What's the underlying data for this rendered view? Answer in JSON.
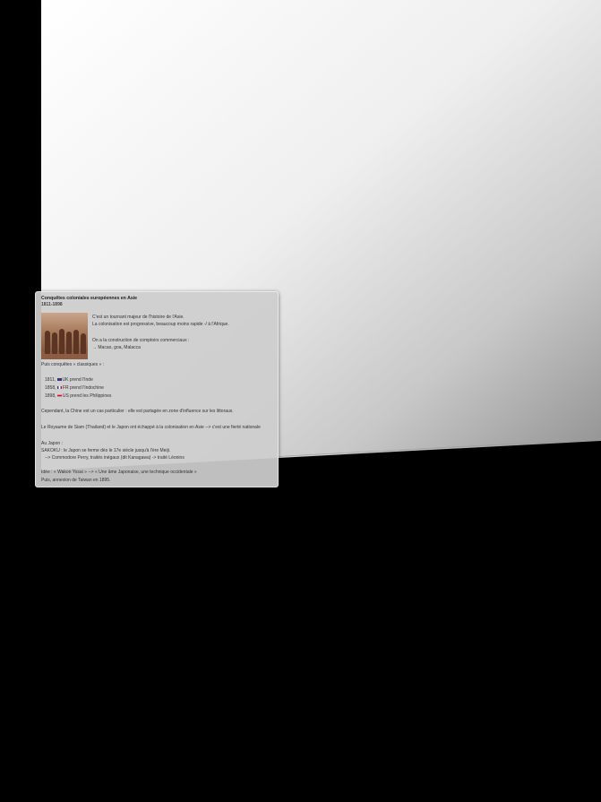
{
  "colors": {
    "background": "#000000",
    "sheet_light": "#ffffff",
    "sheet_dark": "#8f8f8f",
    "card_bg": "#cdcdcd",
    "text": "#333333"
  },
  "card": {
    "title": "Conquêtes coloniales européennes en Asie",
    "dates": "1811-1898",
    "photo_icon": "historical-photo-soldiers",
    "intro": [
      "C'est un tournant majeur de l'histoire de l'Asie.",
      "La colonisation est progressive, beaucoup moins rapide -/ à l'Afrique.",
      "",
      "On a la construction de comptoirs commerciaux :",
      "→  Macao, goa, Malacca"
    ],
    "classic_heading": "Puis conquêtes « classiques » :",
    "conquests": [
      {
        "year": "1811,",
        "flag": "uk-flag",
        "text": "UK prend l'Inde"
      },
      {
        "year": "1858,",
        "flag": "fr-flag",
        "text": "FR prend l'Indochine"
      },
      {
        "year": "1898,",
        "flag": "us-flag",
        "text": "US prend les Philippines"
      }
    ],
    "china": "Cependant, la Chine est un cas particulier : elle est partagée en zone d'influence sur les littoraux.",
    "siam": "Le Royaume de Siam (Thailand) et le Japon ont échappé à la colonisation en Asie --> c'est une fierté nationale",
    "japan_heading": "Au Japon :",
    "sakoku": "SAKOKU : le Japon se ferme dès le 17e siècle jusqu'à l'ère Meiji.",
    "perry": "--> Commodore Perry, traités inégaux (dit Kanagawa) ->  traité Léonins",
    "wakon": "Idée : « Wakon Yosai » --> « Une âme Japonaise, une technique occidentale »",
    "taiwan": "Puis, annexion de Taiwan en 1895."
  }
}
